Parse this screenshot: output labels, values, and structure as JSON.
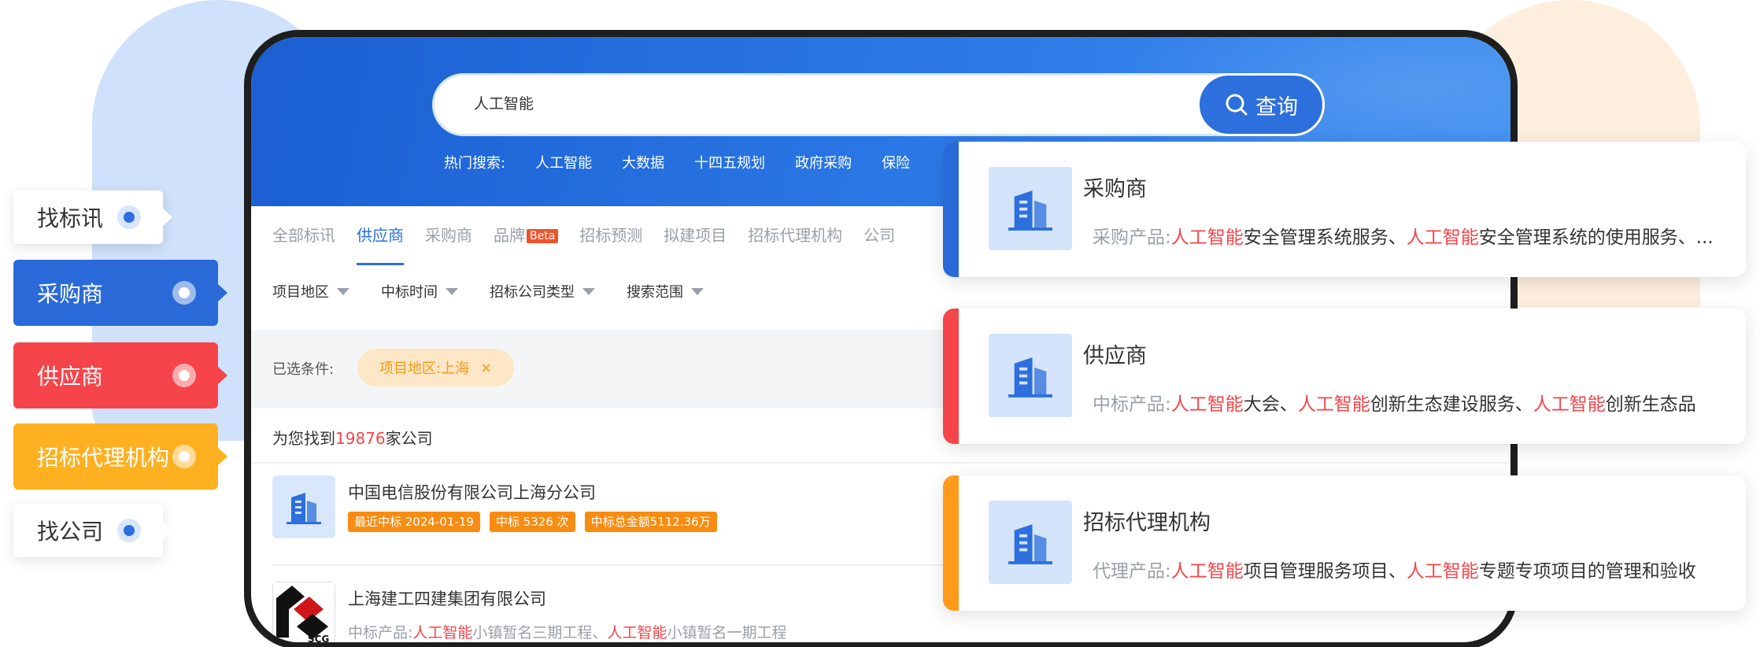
{
  "side_tabs": [
    {
      "label": "找标讯"
    },
    {
      "label": "采购商"
    },
    {
      "label": "供应商"
    },
    {
      "label": "招标代理机构"
    },
    {
      "label": "找公司"
    }
  ],
  "search": {
    "value": "人工智能",
    "button_label": "查询"
  },
  "hot_search": {
    "label": "热门搜索:",
    "items": [
      "人工智能",
      "大数据",
      "十四五规划",
      "政府采购",
      "保险"
    ]
  },
  "tabs": [
    "全部标讯",
    "供应商",
    "采购商",
    "品牌",
    "招标预测",
    "拟建项目",
    "招标代理机构",
    "公司"
  ],
  "beta_badge": "Beta",
  "filters": [
    "项目地区",
    "中标时间",
    "招标公司类型",
    "搜索范围"
  ],
  "selected": {
    "label": "已选条件:",
    "chip": "项目地区:上海",
    "chip_close": "×"
  },
  "result": {
    "prefix": "为您找到",
    "count": "19876",
    "suffix": "家公司"
  },
  "companies": [
    {
      "name": "中国电信股份有限公司上海分公司",
      "tags": [
        "最近中标 2024-01-19",
        "中标 5326 次",
        "中标总金额5112.36万"
      ]
    },
    {
      "name": "上海建工四建集团有限公司",
      "logo_text": "SCG",
      "desc_label": "中标产品:",
      "desc_hl1": "人工智能",
      "desc_mid": "小镇暂名三期工程、",
      "desc_hl2": "人工智能",
      "desc_end": "小镇暂名一期工程"
    }
  ],
  "cards": [
    {
      "title": "采购商",
      "label": "采购产品:",
      "hl1": "人工智能",
      "mid": "安全管理系统服务、",
      "hl2": "人工智能",
      "end": "安全管理系统的使用服务、..."
    },
    {
      "title": "供应商",
      "label": "中标产品:",
      "hl1": "人工智能",
      "mid": "大会、",
      "hl2": "人工智能",
      "end": "创新生态建设服务、",
      "hl3": "人工智能",
      "end2": "创新生态品"
    },
    {
      "title": "招标代理机构",
      "label": "代理产品:",
      "hl1": "人工智能",
      "mid": "项目管理服务项目、",
      "hl2": "人工智能",
      "end": "专题专项项目的管理和验收"
    }
  ],
  "colors": {
    "primary": "#2a6ad8",
    "red": "#f5454a",
    "orange": "#ffb020",
    "highlight": "#f5454a"
  }
}
